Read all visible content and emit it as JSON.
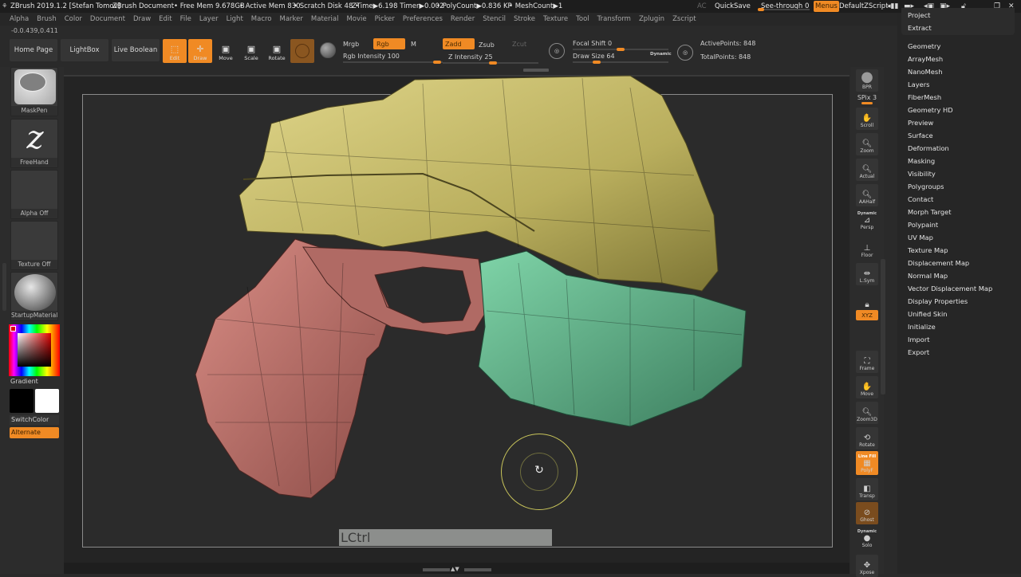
{
  "titlebar": {
    "app_title": "ZBrush 2019.1.2 [Stefan Tomov]",
    "document": "ZBrush Document",
    "free_mem": "• Free Mem 9.678GB",
    "active_mem": "• Active Mem 830",
    "scratch_disk": "• Scratch Disk 48 •",
    "ztime": "ZTime▶6.198 Timer▶0.002",
    "polycount": "• PolyCount▶0.836 KP",
    "meshcount": "• MeshCount▶1",
    "ac": "AC",
    "quicksave": "QuickSave",
    "see_through": "See-through  0",
    "see_through_value": 0,
    "menus": "Menus",
    "script": "DefaultZScript"
  },
  "menubar": [
    "Alpha",
    "Brush",
    "Color",
    "Document",
    "Draw",
    "Edit",
    "File",
    "Layer",
    "Light",
    "Macro",
    "Marker",
    "Material",
    "Movie",
    "Picker",
    "Preferences",
    "Render",
    "Stencil",
    "Stroke",
    "Texture",
    "Tool",
    "Transform",
    "Zplugin",
    "Zscript"
  ],
  "coordinates": "-0.0.439,0.411",
  "toolbar": {
    "home_page": "Home Page",
    "lightbox": "LightBox",
    "live_boolean": "Live Boolean",
    "edit": "Edit",
    "draw": "Draw",
    "move": "Move",
    "scale": "Scale",
    "rotate": "Rotate",
    "mrgb": "Mrgb",
    "rgb": "Rgb",
    "m": "M",
    "rgb_intensity_label": "Rgb Intensity 100",
    "rgb_intensity": 100,
    "zadd": "Zadd",
    "zsub": "Zsub",
    "zcut": "Zcut",
    "z_intensity_label": "Z Intensity 25",
    "z_intensity": 25,
    "focal_shift_label": "Focal Shift 0",
    "focal_shift": 0,
    "draw_size_label": "Draw Size 64",
    "draw_size": 64,
    "dynamic": "Dynamic",
    "active_points": "ActivePoints: 848",
    "total_points": "TotalPoints: 848"
  },
  "left_shelf": {
    "brush": "MaskPen",
    "stroke": "FreeHand",
    "alpha": "Alpha Off",
    "texture": "Texture Off",
    "material": "StartupMaterial",
    "gradient": "Gradient",
    "switch_color": "SwitchColor",
    "alternate": "Alternate",
    "main_color": "#000000",
    "secondary_color": "#ffffff"
  },
  "right_shelf": [
    {
      "label": "BPR",
      "icon": "bpr-sphere-icon"
    },
    {
      "label": "SPix 3",
      "icon": "spix-slider-icon"
    },
    {
      "label": "Scroll",
      "icon": "scroll-hand-icon"
    },
    {
      "label": "Zoom",
      "icon": "zoom-icon"
    },
    {
      "label": "Actual",
      "icon": "actual-icon"
    },
    {
      "label": "AAHalf",
      "icon": "aahalf-icon"
    },
    {
      "label": "Persp",
      "icon": "persp-icon",
      "sub": "Dynamic"
    },
    {
      "label": "Floor",
      "icon": "floor-icon"
    },
    {
      "label": "L.Sym",
      "icon": "lsym-icon"
    },
    {
      "label": "",
      "icon": "lock-icon"
    },
    {
      "label": "XYZ",
      "icon": "xyz-rotate-icon"
    },
    {
      "label": "Frame",
      "icon": "frame-icon"
    },
    {
      "label": "Move",
      "icon": "move-hand-icon"
    },
    {
      "label": "Zoom3D",
      "icon": "zoom3d-icon"
    },
    {
      "label": "Rotate",
      "icon": "rotate3d-icon"
    },
    {
      "label": "PolyF",
      "icon": "polyframe-icon",
      "sub": "Line Fill"
    },
    {
      "label": "Transp",
      "icon": "transp-icon"
    },
    {
      "label": "Ghost",
      "icon": "ghost-icon"
    },
    {
      "label": "Solo",
      "icon": "solo-icon",
      "sub": "Dynamic"
    },
    {
      "label": "Xpose",
      "icon": "xpose-icon"
    }
  ],
  "tool_palette": {
    "top_items": [
      "Project",
      "Extract"
    ],
    "items": [
      "Geometry",
      "ArrayMesh",
      "NanoMesh",
      "Layers",
      "FiberMesh",
      "Geometry HD",
      "Preview",
      "Surface",
      "Deformation",
      "Masking",
      "Visibility",
      "Polygroups",
      "Contact",
      "Morph Target",
      "Polypaint",
      "UV Map",
      "Texture Map",
      "Displacement Map",
      "Normal Map",
      "Vector Displacement Map",
      "Display Properties",
      "Unified Skin",
      "Initialize",
      "Import",
      "Export"
    ]
  },
  "viewport": {
    "key_overlay": "LCtrl",
    "colors": {
      "slide": "#c9c06a",
      "grip": "#b4706a",
      "trigger": "#5aa784",
      "cursor": "#c8c45a"
    }
  },
  "accent": "#f08a24"
}
